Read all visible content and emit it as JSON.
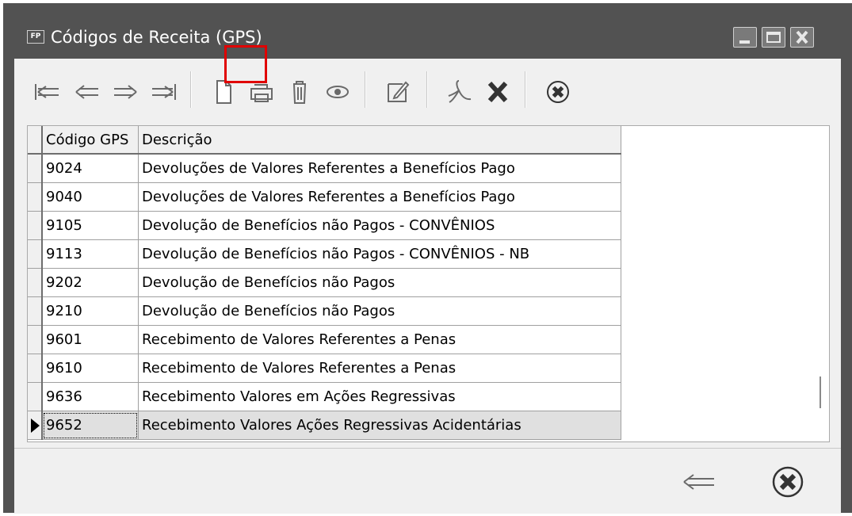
{
  "window": {
    "title": "Códigos de Receita (GPS)",
    "icon_text": "FP",
    "controls": [
      "minimize-icon",
      "maximize-icon",
      "close-icon"
    ]
  },
  "toolbar": {
    "buttons": [
      "first-record-icon",
      "previous-record-icon",
      "next-record-icon",
      "last-record-icon",
      "new-document-icon",
      "print-icon",
      "delete-icon",
      "view-icon",
      "edit-icon",
      "pdf-icon",
      "excel-icon",
      "close-circle-icon"
    ],
    "highlighted": "new-document-icon"
  },
  "grid": {
    "columns": [
      "Código GPS",
      "Descrição"
    ],
    "rows": [
      {
        "code": "9024",
        "desc": "Devoluções de Valores Referentes a Benefícios Pago"
      },
      {
        "code": "9040",
        "desc": "Devoluções de Valores Referentes a Benefícios Pago"
      },
      {
        "code": "9105",
        "desc": "Devolução de Benefícios não Pagos - CONVÊNIOS"
      },
      {
        "code": "9113",
        "desc": "Devolução de Benefícios não Pagos - CONVÊNIOS - NB"
      },
      {
        "code": "9202",
        "desc": "Devolução de Benefícios não Pagos"
      },
      {
        "code": "9210",
        "desc": "Devolução de Benefícios não Pagos"
      },
      {
        "code": "9601",
        "desc": "Recebimento de Valores Referentes a Penas"
      },
      {
        "code": "9610",
        "desc": "Recebimento de Valores Referentes a Penas"
      },
      {
        "code": "9636",
        "desc": "Recebimento Valores em Ações Regressivas"
      },
      {
        "code": "9652",
        "desc": "Recebimento Valores Ações Regressivas Acidentárias"
      }
    ],
    "selected_code": "9652"
  },
  "footer": {
    "buttons": [
      "back-arrow-icon",
      "close-circle-icon"
    ]
  },
  "colors": {
    "titlebar": "#525252",
    "highlight": "#e00000",
    "face": "#f0f0f0"
  }
}
